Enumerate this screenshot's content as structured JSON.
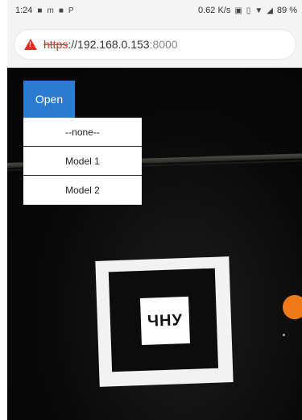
{
  "status_bar": {
    "time": "1:24",
    "left_icons": [
      "■",
      "m",
      "■",
      "P"
    ],
    "speed": "0.62 K/s",
    "battery": "89 %"
  },
  "url_bar": {
    "scheme": "https",
    "host": "://192.168.0.153",
    "port": ":8000"
  },
  "open_button": {
    "label": "Open"
  },
  "dropdown": {
    "items": [
      "--none--",
      "Model 1",
      "Model 2"
    ]
  },
  "marker": {
    "text": "ЧНУ"
  },
  "colors": {
    "accent": "#2b7bd1",
    "warning": "#d93025",
    "fab": "#f07a1a"
  }
}
